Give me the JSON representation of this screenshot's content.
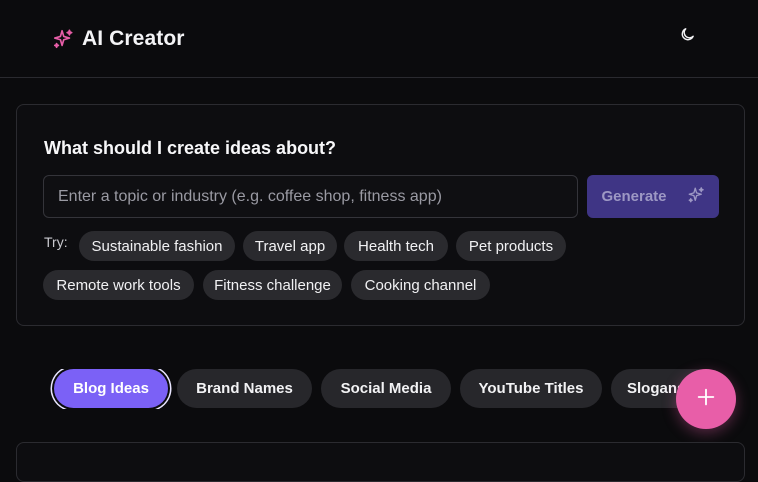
{
  "header": {
    "title": "AI Creator",
    "brand_icon": "sparkles-icon",
    "theme_toggle_icon": "moon-icon"
  },
  "prompt_card": {
    "title": "What should I create ideas about?",
    "input": {
      "value": "",
      "placeholder": "Enter a topic or industry (e.g. coffee shop, fitness app)"
    },
    "generate_label": "Generate",
    "generate_icon": "sparkles-icon",
    "try_label": "Try:",
    "suggestions": [
      "Sustainable fashion",
      "Travel app",
      "Health tech",
      "Pet products",
      "Remote work tools",
      "Fitness challenge",
      "Cooking channel"
    ]
  },
  "categories": {
    "tabs": [
      "Blog Ideas",
      "Brand Names",
      "Social Media",
      "YouTube Titles",
      "Slogans"
    ],
    "active": "Blog Ideas"
  },
  "fab": {
    "icon": "plus-icon"
  },
  "colors": {
    "background": "#0b0b0d",
    "accent": "#7b61f6",
    "generate_button": "#3f3585",
    "fab": "#e85ea8",
    "brand_icon": "#e85ea8",
    "chip": "#2a2a2e"
  }
}
